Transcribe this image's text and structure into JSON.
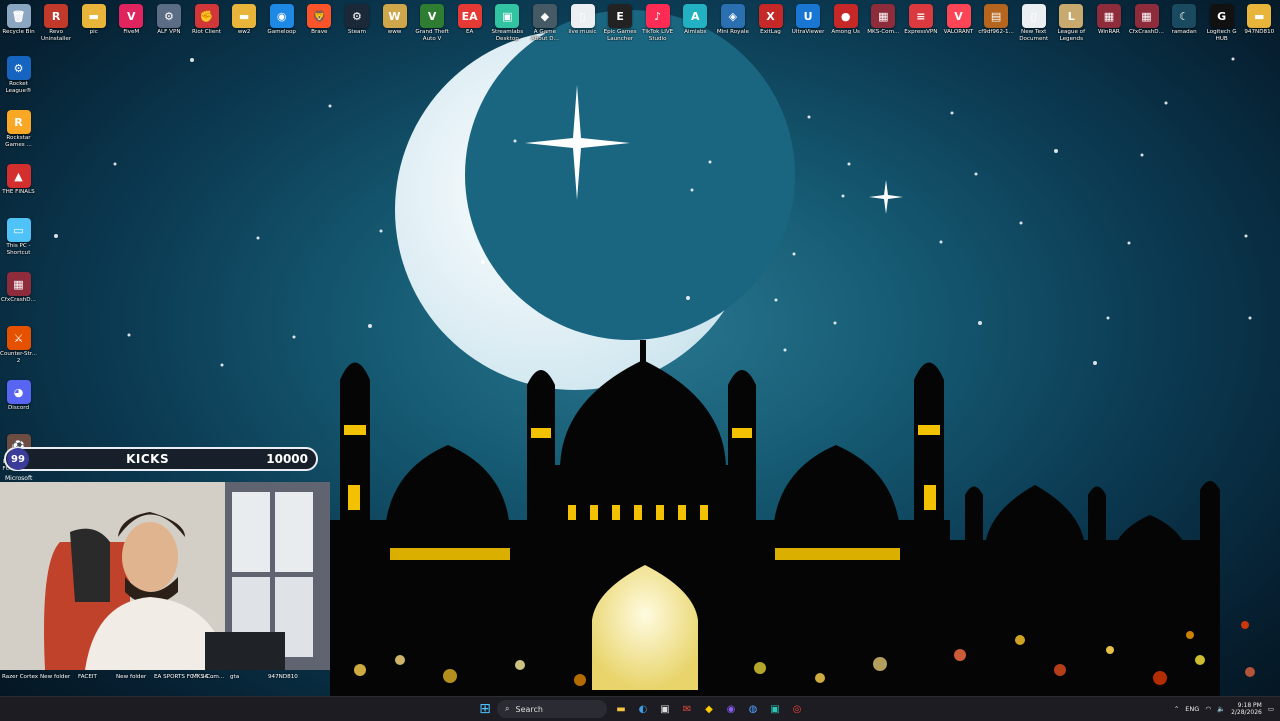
{
  "desktop": {
    "top_icons": [
      {
        "label": "Recycle Bin",
        "icon": "recycle-bin-icon",
        "color": "#8aa6c0",
        "glyph": "🗑"
      },
      {
        "label": "Revo Uninstaller",
        "icon": "revo-icon",
        "color": "#c0392b",
        "glyph": "R"
      },
      {
        "label": "pic",
        "icon": "folder-icon",
        "color": "#e8b53a",
        "glyph": "▬"
      },
      {
        "label": "FiveM",
        "icon": "fivem-icon",
        "color": "#e0245e",
        "glyph": "V"
      },
      {
        "label": "ALF VPN",
        "icon": "vpn-icon",
        "color": "#5b6c85",
        "glyph": "⚙"
      },
      {
        "label": "Riot Client",
        "icon": "riot-icon",
        "color": "#d13639",
        "glyph": "✊"
      },
      {
        "label": "ww2",
        "icon": "folder-icon",
        "color": "#e8b53a",
        "glyph": "▬"
      },
      {
        "label": "Gameloop",
        "icon": "gameloop-icon",
        "color": "#1e88e5",
        "glyph": "◉"
      },
      {
        "label": "Brave",
        "icon": "brave-icon",
        "color": "#fb542b",
        "glyph": "🦁"
      },
      {
        "label": "Steam",
        "icon": "steam-icon",
        "color": "#1b2838",
        "glyph": "⚙"
      },
      {
        "label": "www",
        "icon": "www-icon",
        "color": "#d0a64a",
        "glyph": "W"
      },
      {
        "label": "Grand Theft Auto V",
        "icon": "gta-icon",
        "color": "#2e7d32",
        "glyph": "V"
      },
      {
        "label": "EA",
        "icon": "ea-icon",
        "color": "#e53935",
        "glyph": "EA"
      },
      {
        "label": "Streamlabs Desktop",
        "icon": "streamlabs-icon",
        "color": "#31c3a2",
        "glyph": "▣"
      },
      {
        "label": "A Game About D...",
        "icon": "game-icon",
        "color": "#455a64",
        "glyph": "◆"
      },
      {
        "label": "live music",
        "icon": "file-icon",
        "color": "#eceff1",
        "glyph": "▯"
      },
      {
        "label": "Epic Games Launcher",
        "icon": "epic-icon",
        "color": "#222222",
        "glyph": "E"
      },
      {
        "label": "TikTok LIVE Studio",
        "icon": "tiktok-icon",
        "color": "#fe2c55",
        "glyph": "♪"
      },
      {
        "label": "Aimlabs",
        "icon": "aimlabs-icon",
        "color": "#22b1c2",
        "glyph": "A"
      },
      {
        "label": "Mini Royale",
        "icon": "mini-royale-icon",
        "color": "#2a6fb0",
        "glyph": "◈"
      },
      {
        "label": "ExitLag",
        "icon": "exitlag-icon",
        "color": "#c62828",
        "glyph": "X"
      },
      {
        "label": "UltraViewer",
        "icon": "ultraviewer-icon",
        "color": "#1976d2",
        "glyph": "U"
      },
      {
        "label": "Among Us",
        "icon": "among-us-icon",
        "color": "#c62828",
        "glyph": "●"
      },
      {
        "label": "MKS-Com...",
        "icon": "winrar-icon",
        "color": "#8e2c3c",
        "glyph": "▦"
      },
      {
        "label": "ExpressVPN",
        "icon": "expressvpn-icon",
        "color": "#da3940",
        "glyph": "≡"
      },
      {
        "label": "VALORANT",
        "icon": "valorant-icon",
        "color": "#fd4556",
        "glyph": "V"
      },
      {
        "label": "cf9df962-1...",
        "icon": "image-icon",
        "color": "#b5651d",
        "glyph": "▤"
      },
      {
        "label": "New Text Document",
        "icon": "text-file-icon",
        "color": "#eceff1",
        "glyph": "▯"
      },
      {
        "label": "League of Legends",
        "icon": "league-icon",
        "color": "#c8aa6e",
        "glyph": "L"
      },
      {
        "label": "WinRAR",
        "icon": "winrar-icon",
        "color": "#8e2c3c",
        "glyph": "▦"
      },
      {
        "label": "CfxCrashD...",
        "icon": "winrar-icon",
        "color": "#8e2c3c",
        "glyph": "▦"
      },
      {
        "label": "ramadan",
        "icon": "image-icon",
        "color": "#1a4a60",
        "glyph": "☾"
      },
      {
        "label": "Logitech G HUB",
        "icon": "logitech-icon",
        "color": "#111111",
        "glyph": "G"
      },
      {
        "label": "947ND810",
        "icon": "folder-icon",
        "color": "#e8b53a",
        "glyph": "▬"
      }
    ],
    "left_icons": [
      {
        "label": "Rocket League®",
        "icon": "rocket-league-icon",
        "color": "#1565c0",
        "glyph": "⚙"
      },
      {
        "label": "Rockstar Games ...",
        "icon": "rockstar-icon",
        "color": "#f9a825",
        "glyph": "R"
      },
      {
        "label": "THE FINALS",
        "icon": "the-finals-icon",
        "color": "#d32f2f",
        "glyph": "▲"
      },
      {
        "label": "This PC - Shortcut",
        "icon": "this-pc-icon",
        "color": "#4fc3f7",
        "glyph": "▭"
      },
      {
        "label": "CfxCrashD...",
        "icon": "winrar-icon",
        "color": "#8e2c3c",
        "glyph": "▦"
      },
      {
        "label": "Counter-Str... 2",
        "icon": "cs2-icon",
        "color": "#e65100",
        "glyph": "⚔"
      },
      {
        "label": "Discord",
        "icon": "discord-icon",
        "color": "#5865f2",
        "glyph": "◕"
      },
      {
        "label": "EA SPORTS FC™ 26 S...",
        "icon": "ea-fc-icon",
        "color": "#6d4c41",
        "glyph": "⚽"
      }
    ]
  },
  "overlay": {
    "kicks_badge": "99",
    "kicks_title": "KICKS",
    "kicks_value": "10000",
    "cam_top_label": "Microsoft",
    "bottom_labels": [
      "Razer Cortex",
      "New folder",
      "FACEIT",
      "New folder",
      "EA SPORTS FC™ 26...",
      "MKS-Com...",
      "gta",
      "947ND810"
    ]
  },
  "taskbar": {
    "search_placeholder": "Search",
    "tray_lang": "ENG",
    "time": "9:18 PM",
    "date": "2/28/2026"
  }
}
